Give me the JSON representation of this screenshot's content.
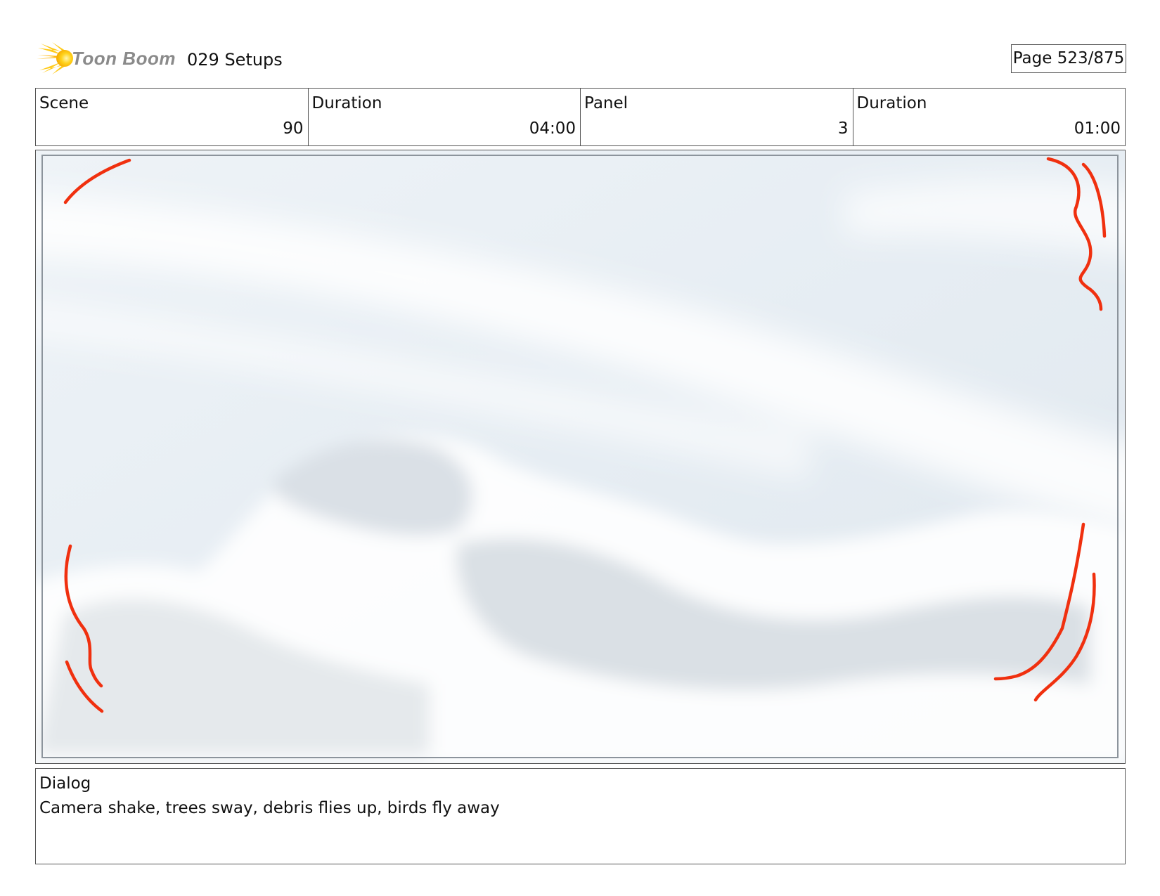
{
  "header": {
    "logo_text": "Toon Boom",
    "project_title": "029 Setups",
    "page": "Page 523/875"
  },
  "info": {
    "scene_label": "Scene",
    "scene_value": "90",
    "scene_duration_label": "Duration",
    "scene_duration_value": "04:00",
    "panel_label": "Panel",
    "panel_value": "3",
    "panel_duration_label": "Duration",
    "panel_duration_value": "01:00"
  },
  "panel": {
    "content": "sky-with-clouds",
    "marks_color": "#f0300f",
    "marks": "camera-shake-corner-marks"
  },
  "dialog": {
    "label": "Dialog",
    "text": "Camera shake, trees sway, debris flies up, birds fly away"
  }
}
